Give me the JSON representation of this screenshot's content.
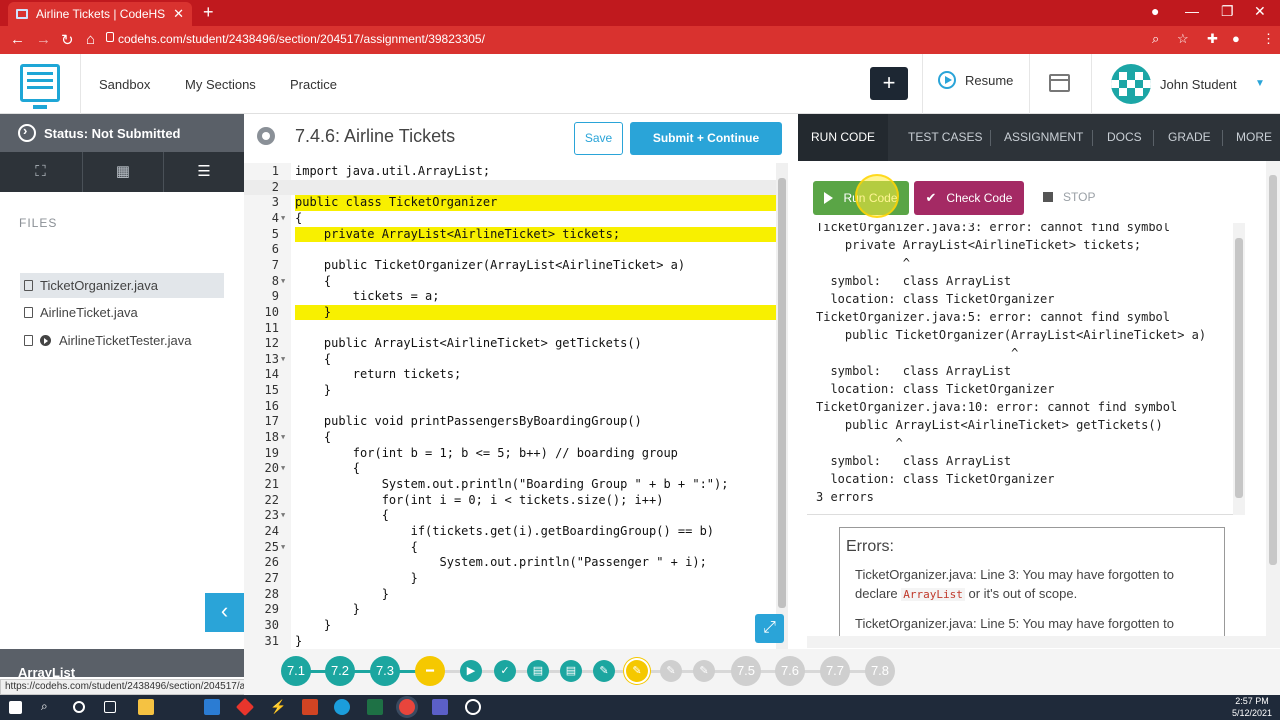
{
  "browser": {
    "tab_title": "Airline Tickets | CodeHS",
    "url": "codehs.com/student/2438496/section/204517/assignment/39823305/",
    "hover_url": "https://codehs.com/student/2438496/section/204517/assignment/39823305/#"
  },
  "header": {
    "nav": [
      "Sandbox",
      "My Sections",
      "Practice"
    ],
    "add_label": "+",
    "resume_label": "Resume",
    "user_name": "John Student"
  },
  "sidebar": {
    "status": "Status: Not Submitted",
    "files_label": "FILES",
    "files": [
      "TicketOrganizer.java",
      "AirlineTicket.java",
      "AirlineTicketTester.java"
    ],
    "collapse_label": "‹",
    "bottom_label": "ArrayList"
  },
  "editor": {
    "title": "7.4.6: Airline Tickets",
    "save_label": "Save",
    "submit_label": "Submit + Continue",
    "lines": [
      "import java.util.ArrayList;",
      "",
      "public class TicketOrganizer",
      "{",
      "    private ArrayList<AirlineTicket> tickets;",
      "",
      "    public TicketOrganizer(ArrayList<AirlineTicket> a)",
      "    {",
      "        tickets = a;",
      "    }",
      "",
      "    public ArrayList<AirlineTicket> getTickets()",
      "    {",
      "        return tickets;",
      "    }",
      "",
      "    public void printPassengersByBoardingGroup()",
      "    {",
      "        for(int b = 1; b <= 5; b++) // boarding group",
      "        {",
      "            System.out.println(\"Boarding Group \" + b + \":\");",
      "            for(int i = 0; i < tickets.size(); i++)",
      "            {",
      "                if(tickets.get(i).getBoardingGroup() == b)",
      "                {",
      "                    System.out.println(\"Passenger \" + i);",
      "                }",
      "            }",
      "        }",
      "    }",
      "}"
    ],
    "highlighted_lines": [
      3,
      5,
      10
    ],
    "current_line": 2,
    "fold_lines": [
      4,
      8,
      13,
      18,
      20,
      23,
      25
    ]
  },
  "right_panel": {
    "tabs": [
      "RUN CODE",
      "TEST CASES",
      "ASSIGNMENT",
      "DOCS",
      "GRADE",
      "MORE"
    ],
    "run_label": "Run Code",
    "check_label": "Check Code",
    "stop_label": "STOP",
    "output": [
      "TicketOrganizer.java:3: error: cannot find symbol",
      "    private ArrayList<AirlineTicket> tickets;",
      "            ^",
      "  symbol:   class ArrayList",
      "  location: class TicketOrganizer",
      "TicketOrganizer.java:5: error: cannot find symbol",
      "    public TicketOrganizer(ArrayList<AirlineTicket> a)",
      "                           ^",
      "  symbol:   class ArrayList",
      "  location: class TicketOrganizer",
      "TicketOrganizer.java:10: error: cannot find symbol",
      "    public ArrayList<AirlineTicket> getTickets()",
      "           ^",
      "  symbol:   class ArrayList",
      "  location: class TicketOrganizer",
      "3 errors"
    ],
    "errors_title": "Errors:",
    "error1_pre": "TicketOrganizer.java: Line 3: You may have forgotten to declare ",
    "error1_code": "ArrayList",
    "error1_post": " or it's out of scope.",
    "error2": "TicketOrganizer.java: Line 5: You may have forgotten to"
  },
  "progress": {
    "lessons_done": [
      "7.1",
      "7.2",
      "7.3"
    ],
    "lessons_todo": [
      "7.5",
      "7.6",
      "7.7",
      "7.8"
    ]
  },
  "clock": {
    "time": "2:57 PM",
    "date": "5/12/2021"
  },
  "colors": {
    "brand": "#2aa4d8",
    "run": "#5aa546",
    "check": "#a42a64",
    "highlight": "#f8f000",
    "chrome": "#c0191e"
  }
}
